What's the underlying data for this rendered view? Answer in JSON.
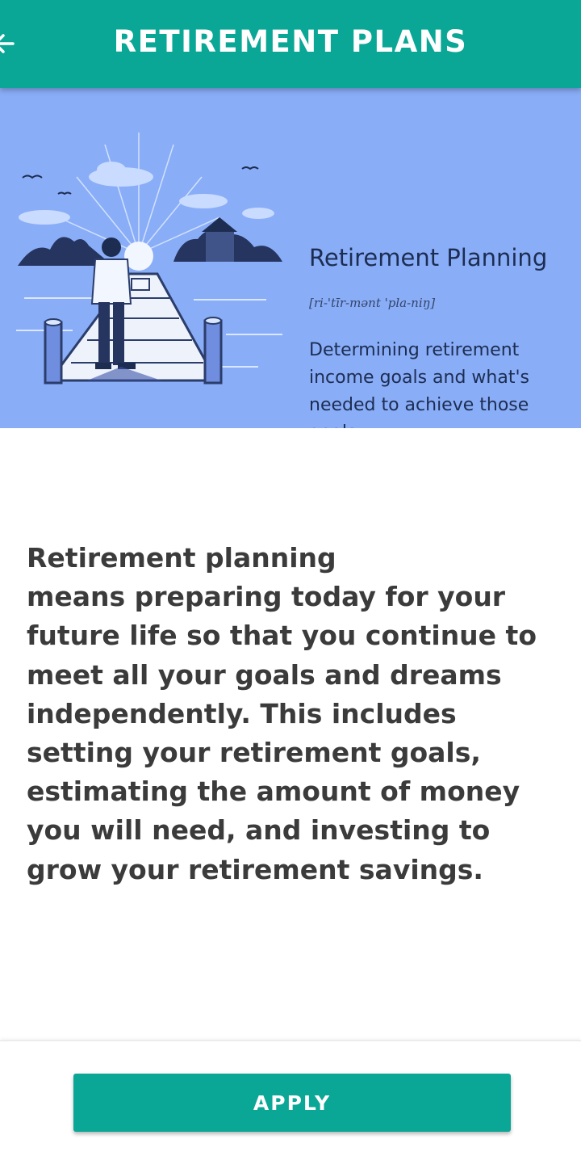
{
  "app_bar": {
    "title": "RETIREMENT PLANS",
    "back_icon": "arrow-left-icon",
    "color": "#0aa696"
  },
  "hero_image": {
    "heading": "Retirement Planning",
    "phonetic": "[ri-'tīr-mənt 'pla-niŋ]",
    "definition": "Determining retirement income goals and what's needed to achieve those goals.",
    "background": "#89adf7"
  },
  "description": " Retirement planning\nmeans preparing today for your future life so that you continue to meet all your goals and dreams independently. This includes setting your retirement goals, estimating the amount of money you will need, and investing to grow your retirement savings.",
  "bottom_bar": {
    "apply_label": "APPLY"
  }
}
